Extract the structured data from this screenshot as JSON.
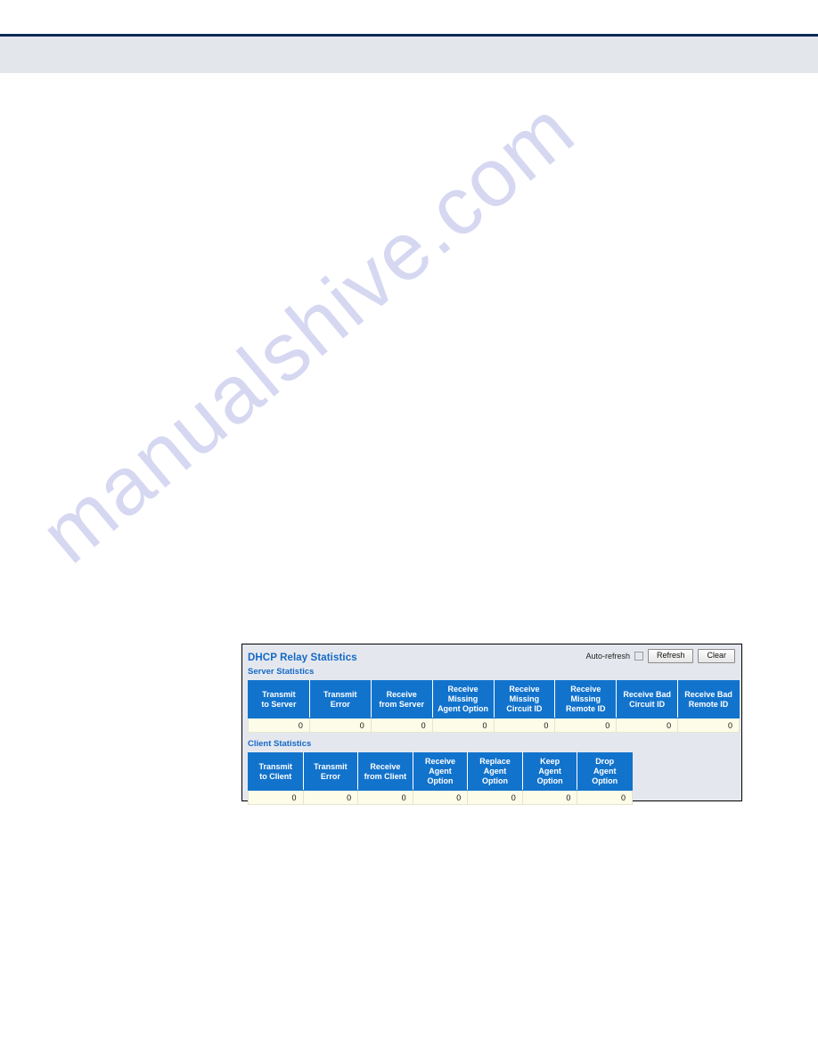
{
  "page": {
    "watermark_text": "manualshive.com",
    "top_rule_color": "#0d2a56",
    "top_band_color": "#e3e7ec"
  },
  "panel": {
    "title": "DHCP Relay Statistics",
    "accent_color": "#1569c7",
    "header_cell_color": "#1273cc",
    "value_row_color": "#fdfce8",
    "controls": {
      "autorefresh_label": "Auto-refresh",
      "autorefresh_checked": false,
      "refresh_label": "Refresh",
      "clear_label": "Clear"
    },
    "server_section": {
      "subtitle": "Server Statistics",
      "columns": [
        "Transmit\nto Server",
        "Transmit\nError",
        "Receive\nfrom Server",
        "Receive Missing\nAgent Option",
        "Receive Missing\nCircuit ID",
        "Receive Missing\nRemote ID",
        "Receive Bad\nCircuit ID",
        "Receive Bad\nRemote ID"
      ],
      "columns_line1": [
        "Transmit",
        "Transmit",
        "Receive",
        "Receive Missing",
        "Receive Missing",
        "Receive Missing",
        "Receive Bad",
        "Receive Bad"
      ],
      "columns_line2": [
        "to Server",
        "Error",
        "from Server",
        "Agent Option",
        "Circuit ID",
        "Remote ID",
        "Circuit ID",
        "Remote ID"
      ],
      "values": [
        "0",
        "0",
        "0",
        "0",
        "0",
        "0",
        "0",
        "0"
      ]
    },
    "client_section": {
      "subtitle": "Client Statistics",
      "columns": [
        "Transmit\nto Client",
        "Transmit\nError",
        "Receive\nfrom Client",
        "Receive\nAgent Option",
        "Replace\nAgent Option",
        "Keep\nAgent Option",
        "Drop\nAgent Option"
      ],
      "columns_line1": [
        "Transmit",
        "Transmit",
        "Receive",
        "Receive",
        "Replace",
        "Keep",
        "Drop"
      ],
      "columns_line2": [
        "to Client",
        "Error",
        "from Client",
        "Agent Option",
        "Agent Option",
        "Agent Option",
        "Agent Option"
      ],
      "values": [
        "0",
        "0",
        "0",
        "0",
        "0",
        "0",
        "0"
      ]
    }
  }
}
